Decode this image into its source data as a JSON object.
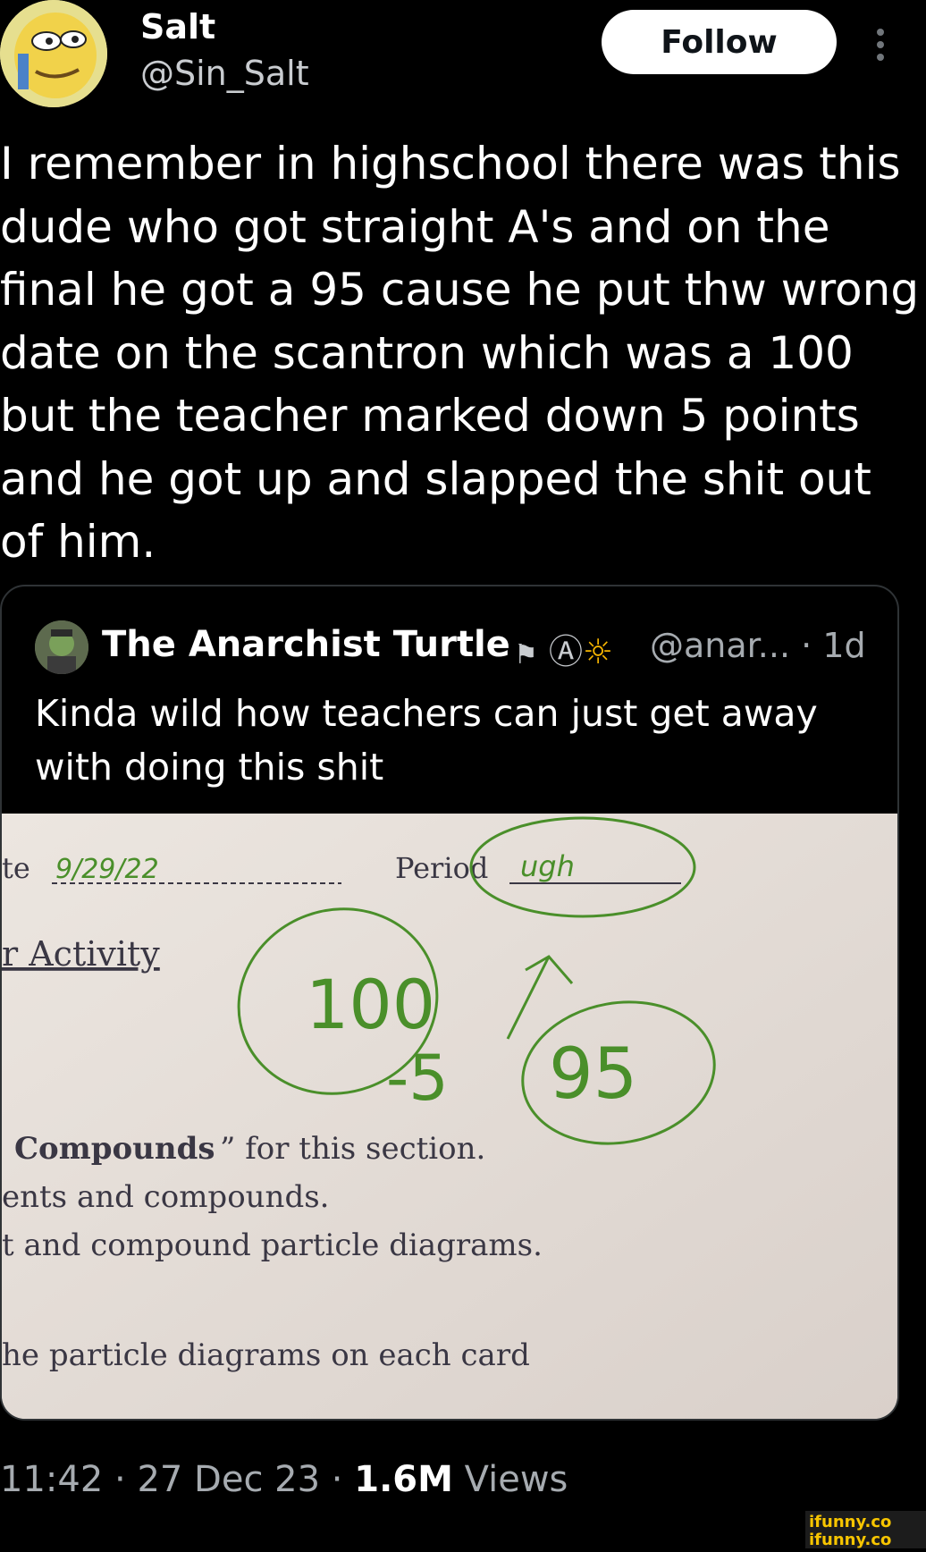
{
  "user": {
    "name": "Salt",
    "handle": "@Sin_Salt"
  },
  "follow_label": "Follow",
  "tweet_text": "I remember in highschool there was this\ndude who got straight A's and on the\nfinal he got a 95 cause he put thw wrong\ndate on the scantron which was a 100\nbut the teacher marked down 5 points\nand he got up and slapped the shit out\nof him.",
  "quoted": {
    "name": "The Anarchist Turtle",
    "badges": "Ⓐ",
    "handle": "@anar...",
    "sep": "·",
    "age": "1d",
    "text": "Kinda wild how teachers can just get away\nwith doing this shit",
    "photo": {
      "date_label": "te",
      "date_value": "9/29/22",
      "period_label": "Period",
      "period_value": "ugh",
      "heading": "r Activity",
      "score": "100",
      "deduction": "-5",
      "final_score": "95",
      "line1_bold": "Compounds",
      "line1_rest": "” for this section.",
      "line2": "ents and compounds.",
      "line3": "t and compound particle diagrams.",
      "line4": "he particle diagrams on each card",
      "ink_color": "#4a8f2a"
    }
  },
  "meta": {
    "time": "11:42",
    "date": "27 Dec 23",
    "views_count": "1.6M",
    "views_label": "Views"
  },
  "watermark": {
    "line1": "ifunny.co",
    "line2": "ifunny.co"
  },
  "colors": {
    "background": "#000000",
    "muted": "#a6abb0",
    "border": "#2f3336"
  }
}
